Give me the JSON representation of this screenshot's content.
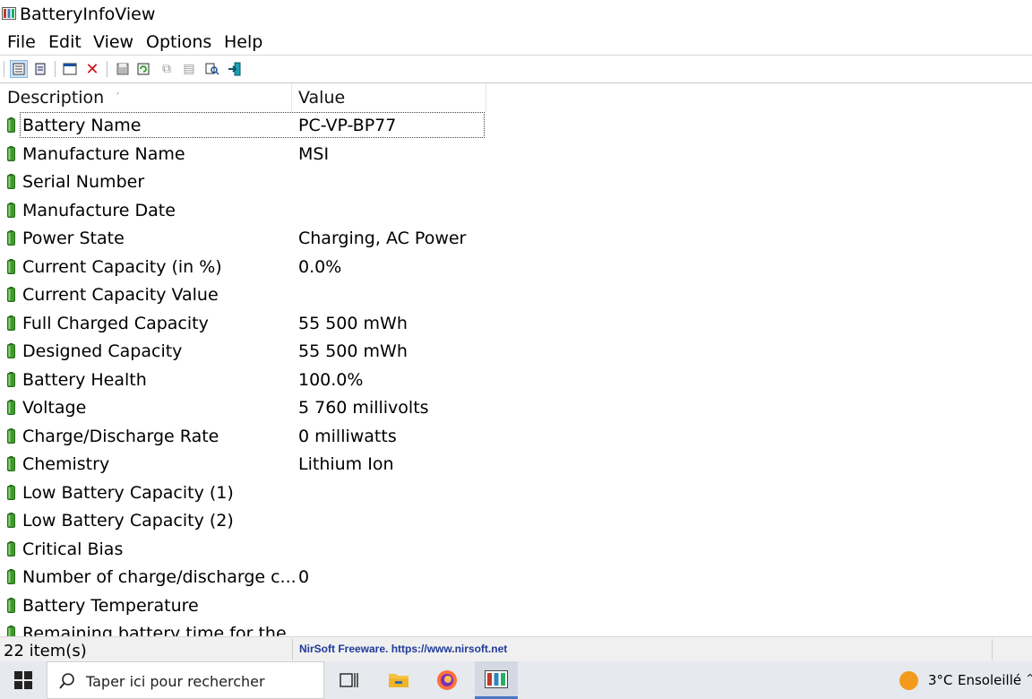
{
  "window": {
    "title": "BatteryInfoView"
  },
  "menu": [
    "File",
    "Edit",
    "View",
    "Options",
    "Help"
  ],
  "toolbar": {
    "buttons": [
      "properties-icon",
      "clipboard-icon",
      "html-report-icon",
      "delete-icon",
      "save-icon",
      "refresh-icon",
      "copy-icon",
      "options-icon",
      "find-icon",
      "exit-icon"
    ]
  },
  "list": {
    "columns": [
      "Description",
      "Value"
    ],
    "sort_indicator": "ˊ",
    "rows": [
      {
        "description": "Battery Name",
        "value": "PC-VP-BP77"
      },
      {
        "description": "Manufacture Name",
        "value": "MSI"
      },
      {
        "description": "Serial Number",
        "value": ""
      },
      {
        "description": "Manufacture Date",
        "value": ""
      },
      {
        "description": "Power State",
        "value": "Charging, AC Power"
      },
      {
        "description": "Current Capacity (in %)",
        "value": "0.0%"
      },
      {
        "description": "Current Capacity Value",
        "value": ""
      },
      {
        "description": "Full Charged Capacity",
        "value": "55 500 mWh"
      },
      {
        "description": "Designed Capacity",
        "value": "55 500 mWh"
      },
      {
        "description": "Battery Health",
        "value": "100.0%"
      },
      {
        "description": "Voltage",
        "value": "5 760 millivolts"
      },
      {
        "description": "Charge/Discharge Rate",
        "value": "0 milliwatts"
      },
      {
        "description": "Chemistry",
        "value": "Lithium Ion"
      },
      {
        "description": "Low Battery Capacity (1)",
        "value": ""
      },
      {
        "description": "Low Battery Capacity (2)",
        "value": ""
      },
      {
        "description": "Critical Bias",
        "value": ""
      },
      {
        "description": "Number of charge/discharge c...",
        "value": "0"
      },
      {
        "description": "Battery Temperature",
        "value": ""
      },
      {
        "description": "Remaining battery time for the...",
        "value": ""
      }
    ]
  },
  "status": {
    "count": "22 item(s)",
    "credit": "NirSoft Freeware. https://www.nirsoft.net"
  },
  "taskbar": {
    "search_placeholder": "Taper ici pour rechercher",
    "weather_temp": "3°C",
    "weather_condition": "Ensoleillé"
  },
  "colors": {
    "battery_green": "#3f9a2e",
    "credit_blue": "#1f3a9a",
    "taskbar": "#e6e9ee"
  }
}
